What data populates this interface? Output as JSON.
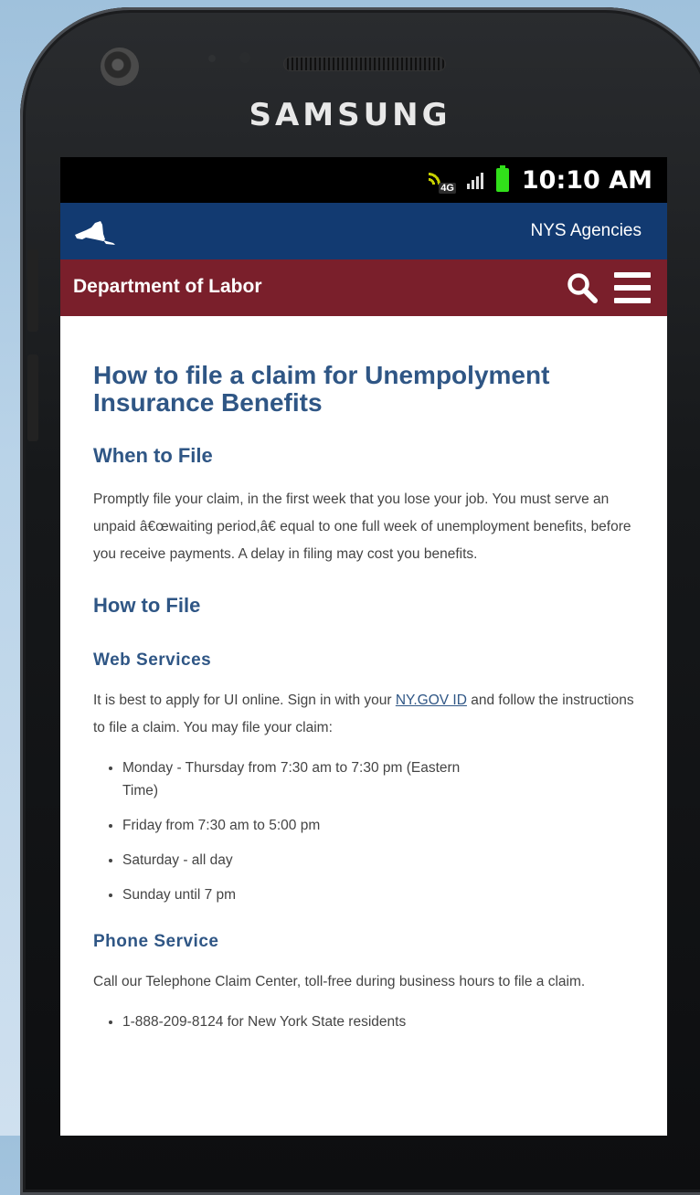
{
  "device": {
    "brand": "SAMSUNG"
  },
  "status_bar": {
    "network": "4G",
    "time": "10:10 AM"
  },
  "header": {
    "agencies_link": "NYS Agencies",
    "department": "Department of Labor"
  },
  "page": {
    "title": "How to file a claim for Unempolyment Insurance Benefits",
    "when_heading": "When to File",
    "when_text": "Promptly file your claim, in the first week that you lose your job. You must serve an unpaid â€œwaiting period,â€ equal to one full week of unemployment benefits, before you receive payments. A delay in filing may cost you benefits.",
    "how_heading": "How to File",
    "web_heading": "Web Services",
    "web_text_before": "It is best to apply for UI online. Sign in with your ",
    "web_link": "NY.GOV ID",
    "web_text_after": " and follow the instructions to file a claim.  You may file your claim:",
    "web_hours": [
      "Monday - Thursday from 7:30 am to 7:30 pm (Eastern Time)",
      "Friday from 7:30 am to 5:00 pm",
      "Saturday - all day",
      "Sunday until 7 pm"
    ],
    "phone_heading": "Phone Service",
    "phone_text": "Call our Telephone Claim Center, toll-free during business hours to file a claim.",
    "phone_numbers": [
      "1-888-209-8124 for New York State residents"
    ]
  },
  "colors": {
    "top_bar": "#123a71",
    "dept_bar": "#7a1f2b",
    "heading": "#2f5685",
    "battery": "#31e01a"
  }
}
